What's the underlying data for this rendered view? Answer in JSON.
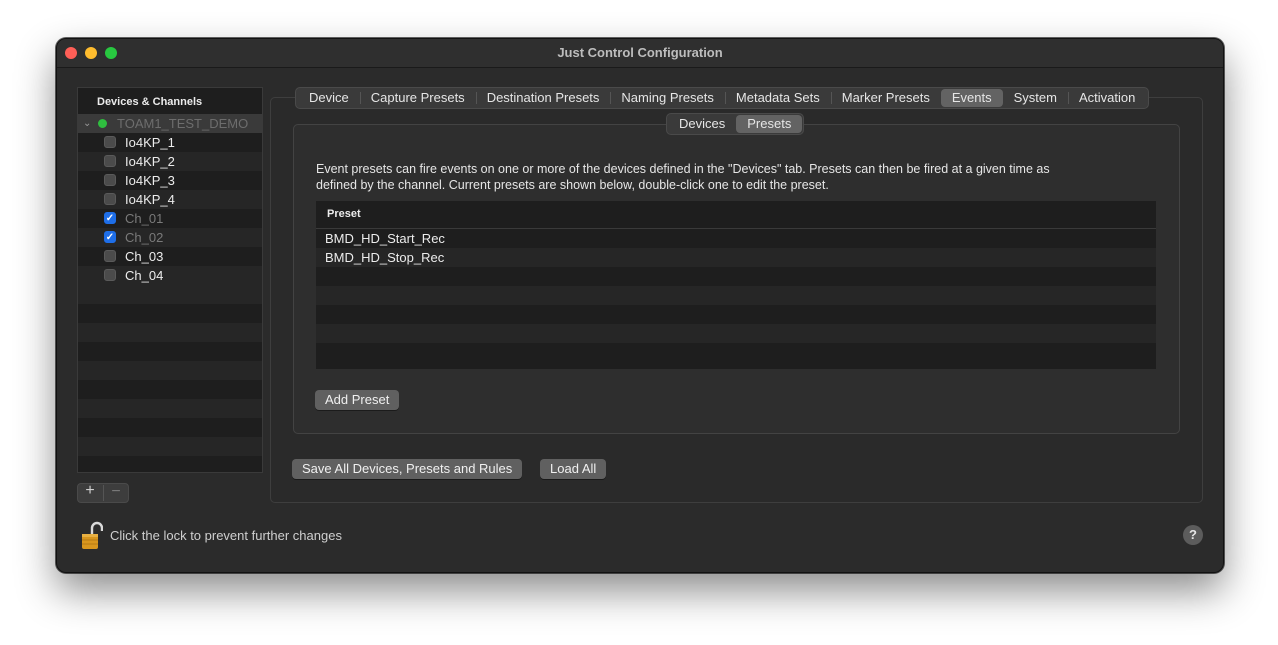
{
  "window": {
    "title": "Just Control Configuration"
  },
  "sidebar": {
    "header": "Devices & Channels",
    "device": {
      "name": "TOAM1_TEST_DEMO",
      "status_color": "#2fbd3f"
    },
    "channels": [
      {
        "label": "Io4KP_1",
        "checked": false,
        "dim": false
      },
      {
        "label": "Io4KP_2",
        "checked": false,
        "dim": false
      },
      {
        "label": "Io4KP_3",
        "checked": false,
        "dim": false
      },
      {
        "label": "Io4KP_4",
        "checked": false,
        "dim": false
      },
      {
        "label": "Ch_01",
        "checked": true,
        "dim": true
      },
      {
        "label": "Ch_02",
        "checked": true,
        "dim": true
      },
      {
        "label": "Ch_03",
        "checked": false,
        "dim": false
      },
      {
        "label": "Ch_04",
        "checked": false,
        "dim": false
      }
    ],
    "add_label": "+",
    "remove_label": "−"
  },
  "tabs": [
    {
      "label": "Device",
      "active": false
    },
    {
      "label": "Capture Presets",
      "active": false
    },
    {
      "label": "Destination Presets",
      "active": false
    },
    {
      "label": "Naming Presets",
      "active": false
    },
    {
      "label": "Metadata Sets",
      "active": false
    },
    {
      "label": "Marker Presets",
      "active": false
    },
    {
      "label": "Events",
      "active": true
    },
    {
      "label": "System",
      "active": false
    },
    {
      "label": "Activation",
      "active": false
    }
  ],
  "subtabs": [
    {
      "label": "Devices",
      "active": false
    },
    {
      "label": "Presets",
      "active": true
    }
  ],
  "events_presets": {
    "description_line1": "Event presets can fire events on one or more of the devices defined in the \"Devices\" tab. Presets can then be fired at a given time as",
    "description_line2": "defined by the channel. Current presets are shown below, double-click one to edit the preset.",
    "table_header": "Preset",
    "presets": [
      "BMD_HD_Start_Rec",
      "BMD_HD_Stop_Rec"
    ],
    "add_button": "Add Preset"
  },
  "footer": {
    "save_all": "Save All Devices, Presets and Rules",
    "load_all": "Load All",
    "lock_text": "Click the lock to prevent further changes",
    "help": "?"
  }
}
